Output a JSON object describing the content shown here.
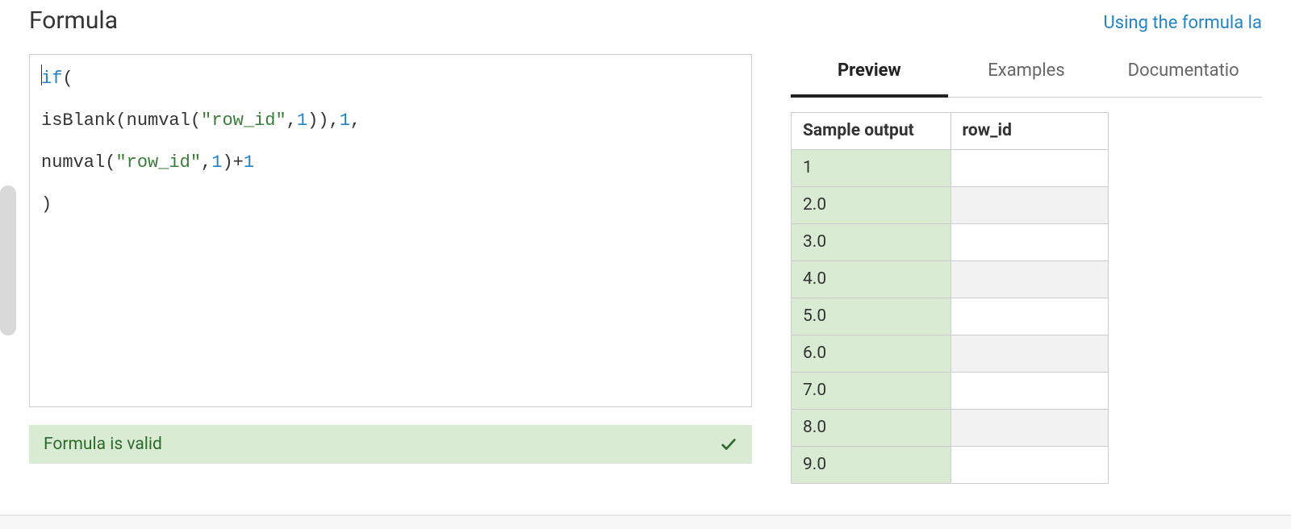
{
  "header": {
    "title": "Formula",
    "help_link": "Using the formula la"
  },
  "editor": {
    "tokens": [
      [
        {
          "t": "cursor"
        },
        {
          "t": "kw",
          "v": "if"
        },
        {
          "t": "plain",
          "v": "("
        }
      ],
      [
        {
          "t": "plain",
          "v": "isBlank"
        },
        {
          "t": "plain",
          "v": "("
        },
        {
          "t": "plain",
          "v": "numval"
        },
        {
          "t": "plain",
          "v": "("
        },
        {
          "t": "str",
          "v": "\"row_id\""
        },
        {
          "t": "plain",
          "v": ","
        },
        {
          "t": "num",
          "v": "1"
        },
        {
          "t": "plain",
          "v": ")),"
        },
        {
          "t": "num",
          "v": "1"
        },
        {
          "t": "plain",
          "v": ","
        }
      ],
      [
        {
          "t": "plain",
          "v": "numval"
        },
        {
          "t": "plain",
          "v": "("
        },
        {
          "t": "str",
          "v": "\"row_id\""
        },
        {
          "t": "plain",
          "v": ","
        },
        {
          "t": "num",
          "v": "1"
        },
        {
          "t": "plain",
          "v": ")+"
        },
        {
          "t": "num",
          "v": "1"
        }
      ],
      [
        {
          "t": "plain",
          "v": ")"
        }
      ]
    ]
  },
  "status": {
    "message": "Formula is valid",
    "ok": true
  },
  "tabs": [
    {
      "id": "preview",
      "label": "Preview",
      "active": true
    },
    {
      "id": "examples",
      "label": "Examples",
      "active": false
    },
    {
      "id": "documentation",
      "label": "Documentatio",
      "active": false
    }
  ],
  "preview": {
    "columns": [
      "Sample output",
      "row_id"
    ],
    "rows": [
      {
        "sample": "1",
        "row_id": ""
      },
      {
        "sample": "2.0",
        "row_id": ""
      },
      {
        "sample": "3.0",
        "row_id": ""
      },
      {
        "sample": "4.0",
        "row_id": ""
      },
      {
        "sample": "5.0",
        "row_id": ""
      },
      {
        "sample": "6.0",
        "row_id": ""
      },
      {
        "sample": "7.0",
        "row_id": ""
      },
      {
        "sample": "8.0",
        "row_id": ""
      },
      {
        "sample": "9.0",
        "row_id": ""
      }
    ]
  }
}
